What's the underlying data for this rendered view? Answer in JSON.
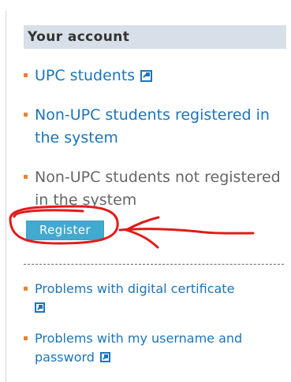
{
  "account_panel": {
    "title": "Your account",
    "links": [
      {
        "label": "UPC students",
        "external": true
      },
      {
        "label": "Non-UPC students registered in the system"
      },
      {
        "label": "Non-UPC students not registered in the system"
      }
    ],
    "register_label": "Register",
    "help_links": [
      {
        "label": "Problems with digital certificate",
        "external": true
      },
      {
        "label": "Problems with my username and password",
        "external": true
      }
    ]
  },
  "icons": {
    "external_link": "external-link-icon"
  },
  "colors": {
    "header_background": "#d7e0e8",
    "link_blue": "#1d74b8",
    "bullet_orange": "#e7822f",
    "register_button": "#42a9cf",
    "annotation_red": "#e01b1b"
  }
}
